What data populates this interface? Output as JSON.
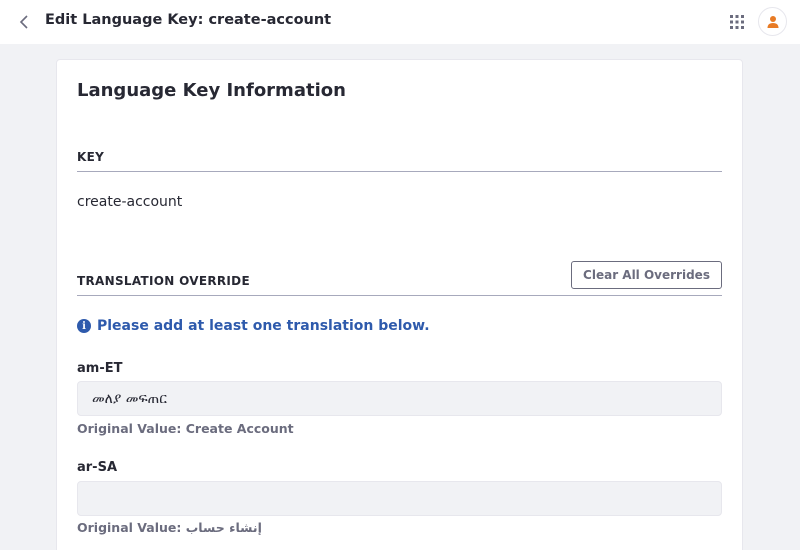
{
  "header": {
    "title": "Edit Language Key: create-account",
    "back_icon": "chevron-left-icon",
    "apps_icon": "grid-icon",
    "avatar_icon": "user-icon",
    "avatar_color": "#e87b25"
  },
  "card": {
    "title": "Language Key Information",
    "key_section": {
      "label": "KEY",
      "value": "create-account"
    },
    "translation_section": {
      "label": "TRANSLATION OVERRIDE",
      "clear_button": "Clear All Overrides",
      "info_message": "Please add at least one translation below.",
      "info_color": "#2e5aac"
    },
    "translations": [
      {
        "locale": "am-ET",
        "value": "መለያ መፍጠር",
        "original_label": "Original Value:",
        "original_value": "Create Account"
      },
      {
        "locale": "ar-SA",
        "value": "",
        "original_label": "Original Value:",
        "original_value": "إنشاء حساب"
      }
    ]
  }
}
